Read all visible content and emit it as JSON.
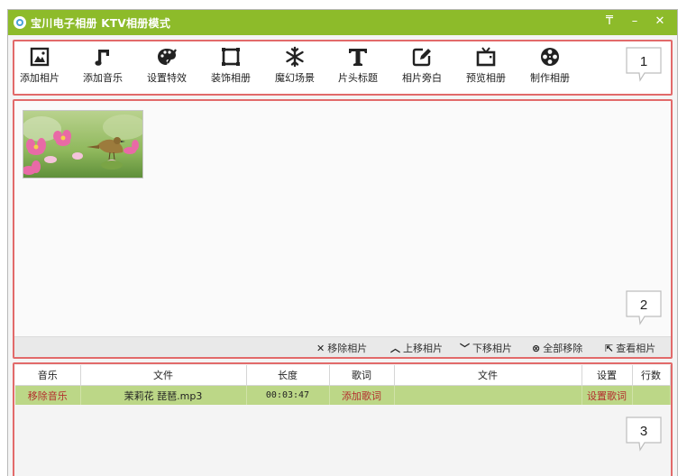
{
  "window": {
    "title": "宝川电子相册 KTV相册模式",
    "controls": {
      "menu": "₸",
      "minimize": "–",
      "close": "✕"
    }
  },
  "toolbar": {
    "items": [
      {
        "label": "添加相片",
        "icon": "add-photo-icon"
      },
      {
        "label": "添加音乐",
        "icon": "music-note-icon"
      },
      {
        "label": "设置特效",
        "icon": "palette-icon"
      },
      {
        "label": "装饰相册",
        "icon": "frame-icon"
      },
      {
        "label": "魔幻场景",
        "icon": "snowflake-icon"
      },
      {
        "label": "片头标题",
        "icon": "title-t-icon"
      },
      {
        "label": "相片旁白",
        "icon": "edit-note-icon"
      },
      {
        "label": "预览相册",
        "icon": "tv-icon"
      },
      {
        "label": "制作相册",
        "icon": "film-reel-icon"
      }
    ]
  },
  "photos": {
    "actions": [
      {
        "glyph": "✕",
        "label": "移除相片"
      },
      {
        "glyph": "︿",
        "label": "上移相片"
      },
      {
        "glyph": "﹀",
        "label": "下移相片"
      },
      {
        "glyph": "⊗",
        "label": "全部移除"
      },
      {
        "glyph": "⇱",
        "label": "查看相片"
      }
    ]
  },
  "music": {
    "columns": [
      "音乐",
      "文件",
      "长度",
      "歌词",
      "文件",
      "设置",
      "行数"
    ],
    "rows": [
      {
        "music": "移除音乐",
        "file": "茉莉花 琵琶.mp3",
        "length": "00:03:47",
        "lyrics": "添加歌词",
        "lyrics_file": "",
        "settings": "设置歌词",
        "lines": ""
      }
    ]
  },
  "markers": [
    "1",
    "2",
    "3"
  ],
  "colors": {
    "title_bar": "#8dbb2a",
    "panel_border": "#e26a6a",
    "row_highlight": "#bcd787",
    "link_red": "#b32d2d"
  }
}
